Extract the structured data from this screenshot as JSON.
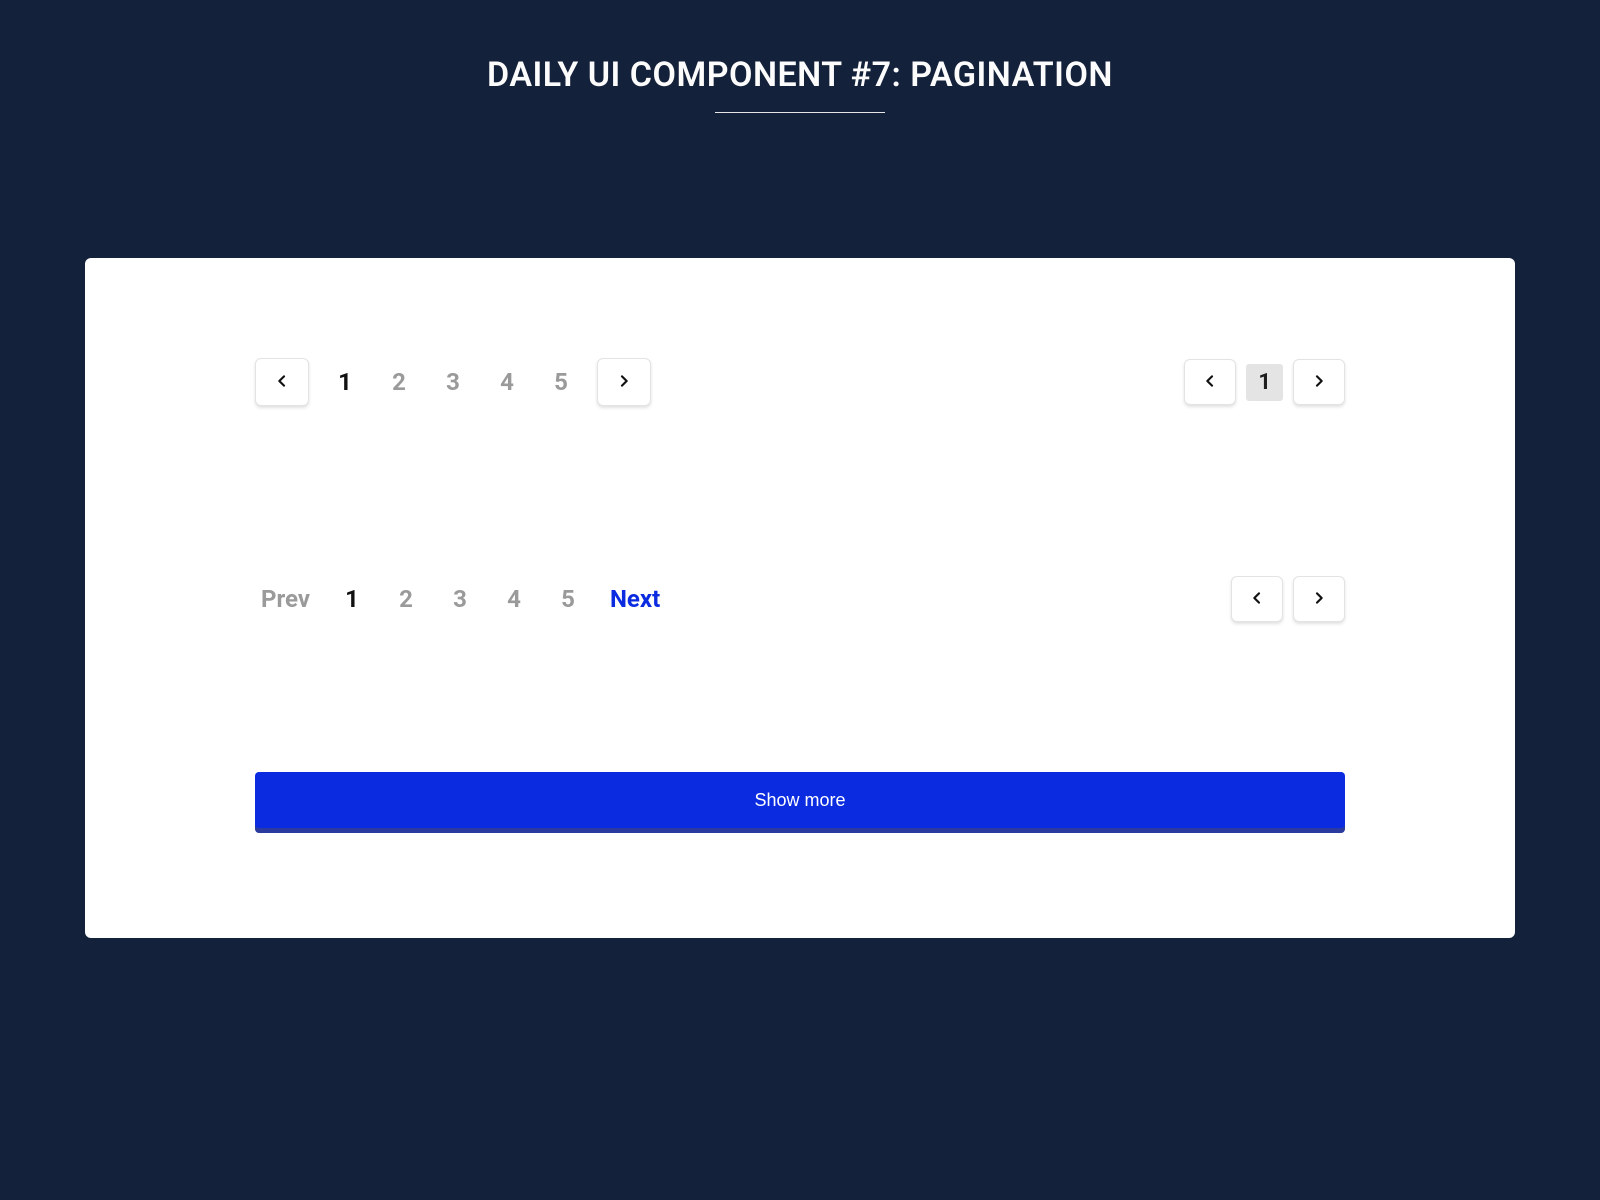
{
  "title": "DAILY UI COMPONENT #7: PAGINATION",
  "colors": {
    "background": "#14213a",
    "card": "#ffffff",
    "primary": "#0a2be0",
    "muted": "#9a9a9a",
    "chip": "#e4e4e4"
  },
  "pagination_a": {
    "pages": [
      "1",
      "2",
      "3",
      "4",
      "5"
    ],
    "active_index": 0
  },
  "pagination_b": {
    "current_label": "1"
  },
  "pagination_c": {
    "prev_label": "Prev",
    "next_label": "Next",
    "pages": [
      "1",
      "2",
      "3",
      "4",
      "5"
    ],
    "active_index": 0
  },
  "show_more_label": "Show more",
  "icons": {
    "chevron_left": "chevron-left-icon",
    "chevron_right": "chevron-right-icon"
  }
}
